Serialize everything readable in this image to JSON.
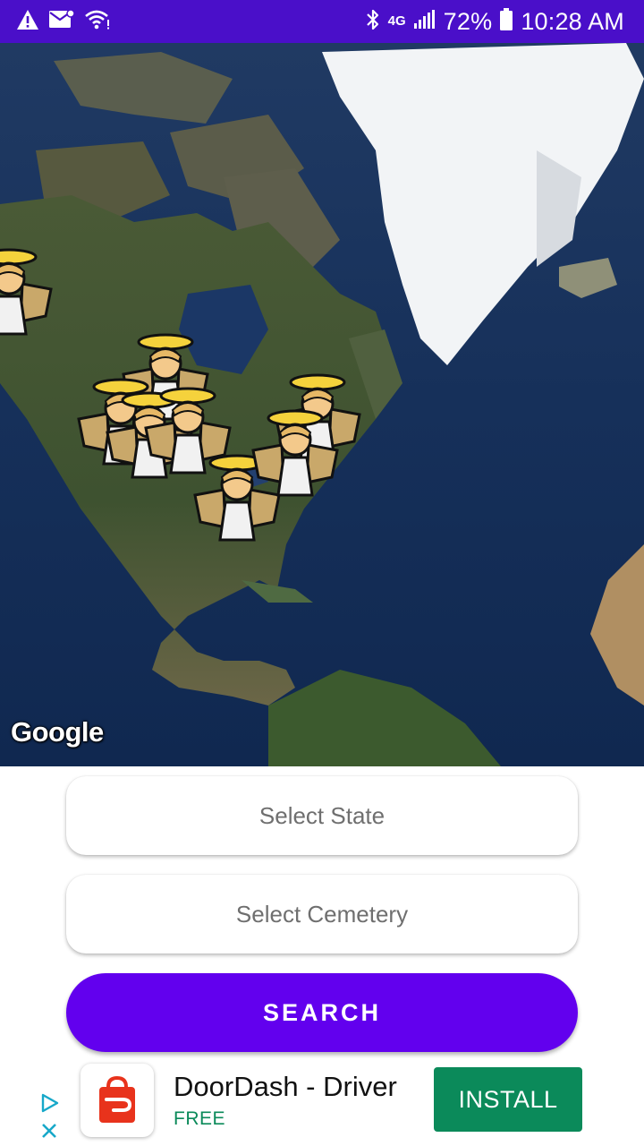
{
  "status_bar": {
    "network": "4G",
    "battery": "72%",
    "time": "10:28 AM",
    "icons": [
      "alert-icon",
      "mail-icon",
      "wifi-icon",
      "bluetooth-icon",
      "signal-icon",
      "battery-icon"
    ]
  },
  "map": {
    "provider_logo": "Google",
    "view": "satellite",
    "marker_icon": "angel-icon"
  },
  "form": {
    "state_placeholder": "Select State",
    "cemetery_placeholder": "Select Cemetery",
    "search_label": "SEARCH"
  },
  "ad": {
    "app_name": "DoorDash - Driver",
    "price": "FREE",
    "install_label": "INSTALL"
  },
  "colors": {
    "status_bar": "#4a0fc9",
    "accent": "#6200ee",
    "install": "#0b8a5a"
  }
}
